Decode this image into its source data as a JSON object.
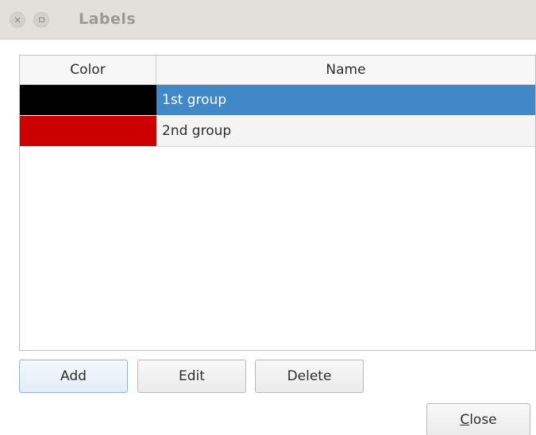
{
  "window": {
    "title": "Labels",
    "close_glyph": "×"
  },
  "table": {
    "columns": [
      "Color",
      "Name"
    ],
    "rows": [
      {
        "color": "#000000",
        "name": "1st group",
        "selected": true
      },
      {
        "color": "#cc0000",
        "name": "2nd group",
        "selected": false
      }
    ]
  },
  "buttons": {
    "add": "Add",
    "edit": "Edit",
    "delete": "Delete",
    "close_mnemonic": "C",
    "close_rest": "lose"
  },
  "colors": {
    "selection": "#4188c8",
    "titlebar": "#e3dfda"
  }
}
